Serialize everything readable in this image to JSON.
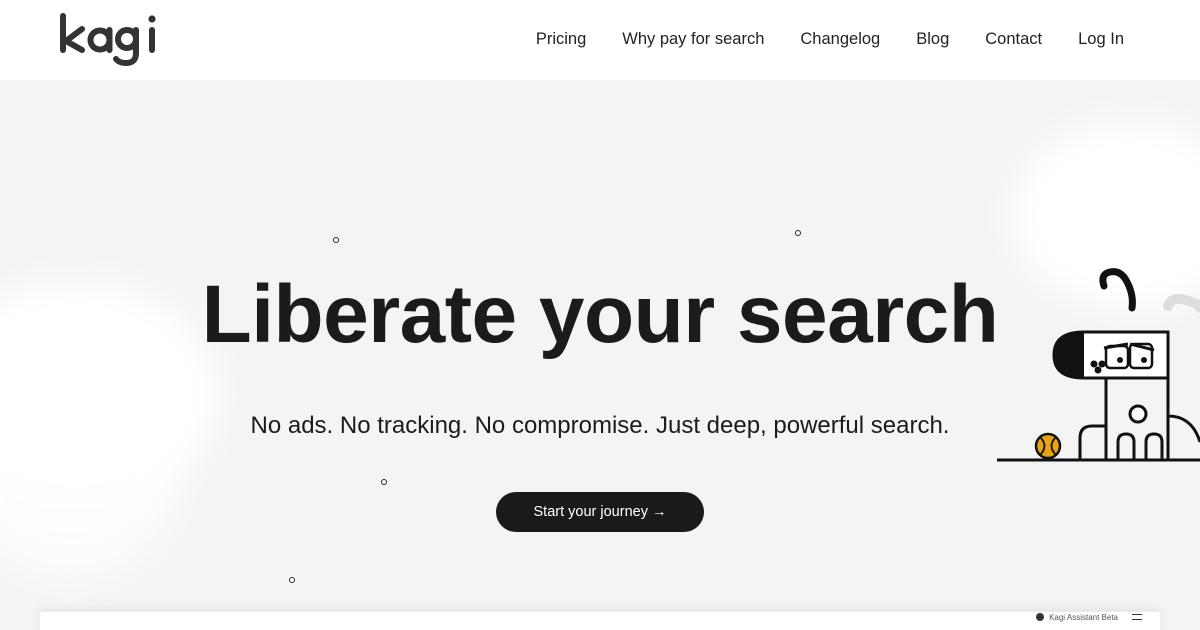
{
  "header": {
    "logo_text": "kagi",
    "nav": [
      {
        "label": "Pricing"
      },
      {
        "label": "Why pay for search"
      },
      {
        "label": "Changelog"
      },
      {
        "label": "Blog"
      },
      {
        "label": "Contact"
      },
      {
        "label": "Log In"
      }
    ]
  },
  "hero": {
    "title": "Liberate your search",
    "subtitle": "No ads. No tracking. No compromise. Just deep, powerful search.",
    "cta_label": "Start your journey →"
  },
  "preview": {
    "label": "Kagi Assistant Beta"
  },
  "icons": [
    "kagi-logo",
    "dog-mascot-illustration",
    "tennis-ball-icon",
    "menu-icon"
  ],
  "colors": {
    "background": "#f4f4f4",
    "header": "#ffffff",
    "text": "#1b1b1b",
    "cta_background": "#1a1a1a",
    "cta_text": "#ffffff",
    "ball": "#e8a317"
  }
}
